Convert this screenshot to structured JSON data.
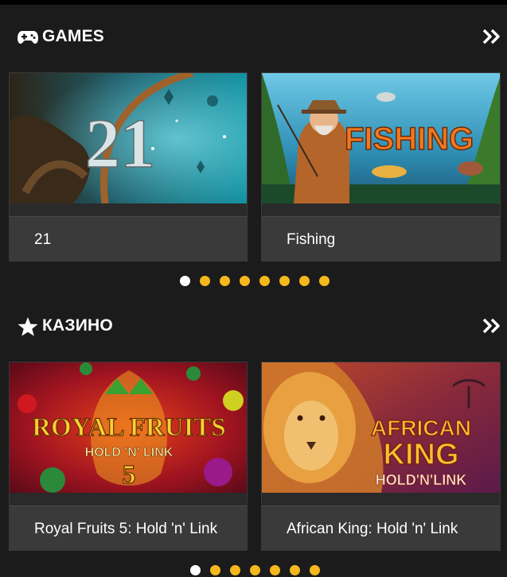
{
  "sections": [
    {
      "title": "GAMES",
      "icon": "gamepad-icon",
      "more_icon": "double-chevron-right-icon",
      "cards": [
        {
          "title": "21",
          "thumb_text": "21"
        },
        {
          "title": "Fishing",
          "thumb_text": "FISHING"
        }
      ],
      "dots": {
        "count": 8,
        "active": 0
      }
    },
    {
      "title": "КАЗИНО",
      "icon": "star-icon",
      "more_icon": "double-chevron-right-icon",
      "cards": [
        {
          "title": "Royal Fruits 5: Hold 'n' Link",
          "thumb_line1": "ROYAL FRUITS",
          "thumb_line2": "HOLD 'N' LINK",
          "thumb_line3": "5"
        },
        {
          "title": "African King: Hold 'n' Link",
          "thumb_line1": "AFRICAN",
          "thumb_line2": "KING",
          "thumb_line3": "HOLD'N'LINK"
        }
      ],
      "dots": {
        "count": 7,
        "active": 0
      }
    }
  ],
  "colors": {
    "background": "#1b1b1b",
    "dot": "#f5b81c",
    "dot_active": "#ffffff",
    "card_label_bg": "#3a3a3a"
  }
}
